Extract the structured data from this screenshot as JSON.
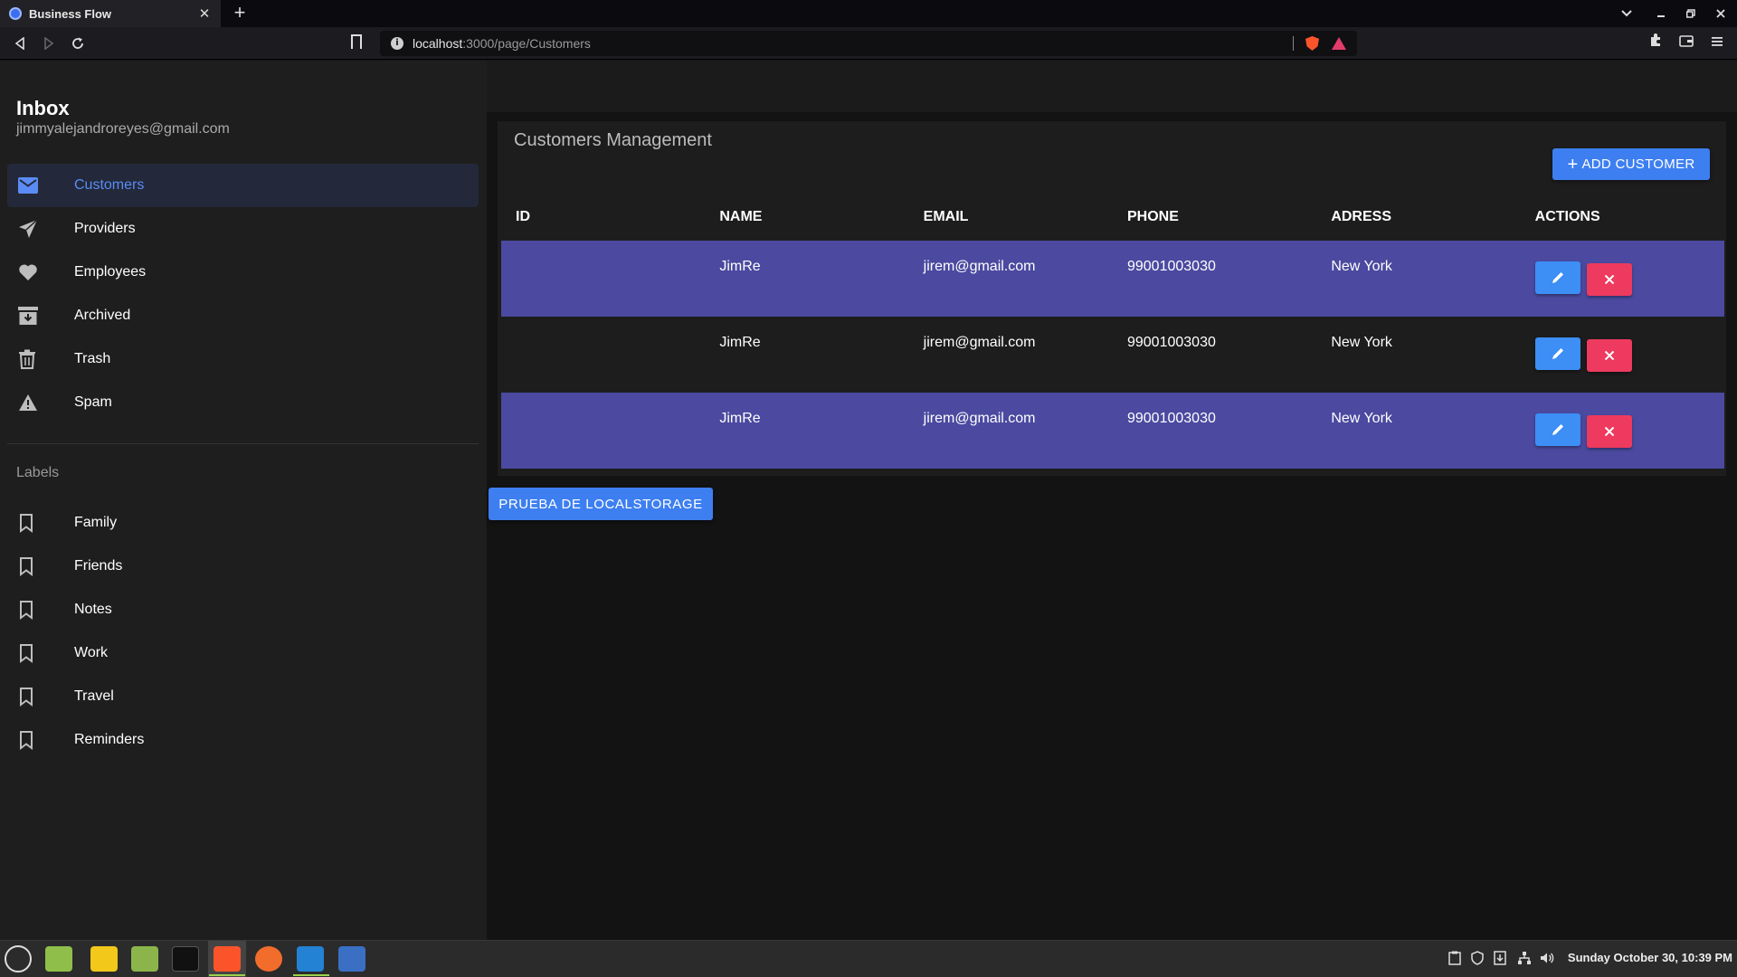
{
  "browser": {
    "tab_title": "Business Flow",
    "tab_close": "✕",
    "new_tab": "+",
    "url_host": "localhost",
    "url_path": ":3000/page/Customers"
  },
  "sidebar": {
    "title": "Inbox",
    "email": "jimmyalejandroreyes@gmail.com",
    "items": [
      {
        "label": "Customers",
        "icon": "mail-icon"
      },
      {
        "label": "Providers",
        "icon": "send-icon"
      },
      {
        "label": "Employees",
        "icon": "heart-icon"
      },
      {
        "label": "Archived",
        "icon": "archive-icon"
      },
      {
        "label": "Trash",
        "icon": "trash-icon"
      },
      {
        "label": "Spam",
        "icon": "warning-icon"
      }
    ],
    "labels_title": "Labels",
    "labels": [
      {
        "label": "Family"
      },
      {
        "label": "Friends"
      },
      {
        "label": "Notes"
      },
      {
        "label": "Work"
      },
      {
        "label": "Travel"
      },
      {
        "label": "Reminders"
      }
    ]
  },
  "main": {
    "title": "Customers Management",
    "add_button": "ADD CUSTOMER",
    "columns": [
      "ID",
      "NAME",
      "EMAIL",
      "PHONE",
      "ADRESS",
      "ACTIONS"
    ],
    "rows": [
      {
        "id": "",
        "name": "JimRe",
        "email": "jirem@gmail.com",
        "phone": "99001003030",
        "address": "New York"
      },
      {
        "id": "",
        "name": "JimRe",
        "email": "jirem@gmail.com",
        "phone": "99001003030",
        "address": "New York"
      },
      {
        "id": "",
        "name": "JimRe",
        "email": "jirem@gmail.com",
        "phone": "99001003030",
        "address": "New York"
      }
    ],
    "localstorage_button": "PRUEBA DE LOCALSTORAGE"
  },
  "taskbar": {
    "clock": "Sunday October 30, 10:39 PM"
  },
  "colors": {
    "accent": "#3d7ff0",
    "row_highlight": "#4b4aa0",
    "delete": "#ee3a5e",
    "active_nav_text": "#5b8cf5"
  }
}
